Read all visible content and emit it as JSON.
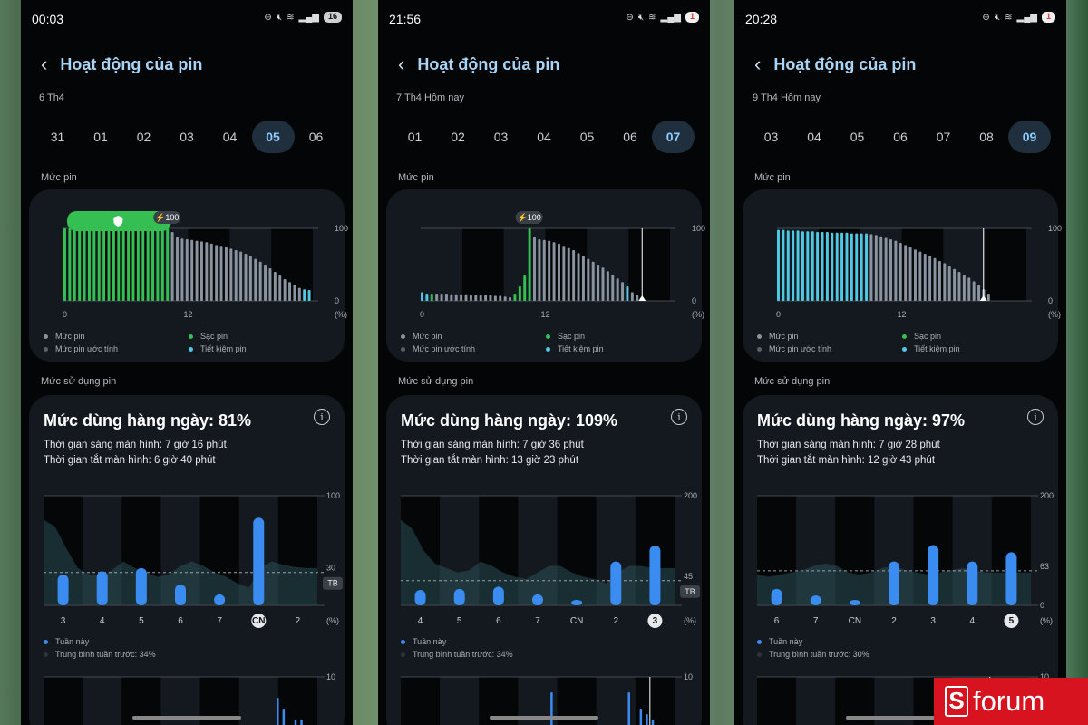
{
  "colors": {
    "battery_level": "#8a93a0",
    "charging": "#35bf52",
    "saving": "#4fc8e3",
    "usage_bar": "#3b8cf0",
    "screen_bg": "#040506",
    "card_bg": "#14191f",
    "title_accent": "#a9d4f5"
  },
  "icons": {
    "back": "chevron-left-icon",
    "info": "info-circle-icon",
    "charge": "lightning-bolt-icon",
    "shield": "shield-icon"
  },
  "phones": [
    {
      "status": {
        "time": "00:03",
        "battery": "16",
        "battery_low": false
      },
      "title": "Hoạt động của pin",
      "date_label": "6 Th4",
      "days": [
        "31",
        "01",
        "02",
        "03",
        "04",
        "05",
        "06"
      ],
      "selected_day": "05",
      "battery_section_label": "Mức pin",
      "battery_chart": {
        "y_max": "100",
        "y_min": "0",
        "unit": "(%)",
        "x_labels": [
          "0",
          "12"
        ],
        "charge_badge": "100",
        "has_shield_band": true,
        "cursor": null,
        "bars": [
          {
            "v": 100,
            "t": "c"
          },
          {
            "v": 100,
            "t": "c"
          },
          {
            "v": 100,
            "t": "c"
          },
          {
            "v": 100,
            "t": "c"
          },
          {
            "v": 100,
            "t": "c"
          },
          {
            "v": 100,
            "t": "c"
          },
          {
            "v": 100,
            "t": "c"
          },
          {
            "v": 100,
            "t": "c"
          },
          {
            "v": 100,
            "t": "c"
          },
          {
            "v": 100,
            "t": "c"
          },
          {
            "v": 100,
            "t": "c"
          },
          {
            "v": 100,
            "t": "c"
          },
          {
            "v": 100,
            "t": "c"
          },
          {
            "v": 100,
            "t": "c"
          },
          {
            "v": 100,
            "t": "c"
          },
          {
            "v": 100,
            "t": "c"
          },
          {
            "v": 100,
            "t": "c"
          },
          {
            "v": 100,
            "t": "c"
          },
          {
            "v": 100,
            "t": "c"
          },
          {
            "v": 100,
            "t": "c"
          },
          {
            "v": 100,
            "t": "c"
          },
          {
            "v": 100,
            "t": "c"
          },
          {
            "v": 95,
            "t": "n"
          },
          {
            "v": 88,
            "t": "n"
          },
          {
            "v": 86,
            "t": "n"
          },
          {
            "v": 85,
            "t": "n"
          },
          {
            "v": 84,
            "t": "n"
          },
          {
            "v": 83,
            "t": "n"
          },
          {
            "v": 82,
            "t": "n"
          },
          {
            "v": 81,
            "t": "n"
          },
          {
            "v": 79,
            "t": "n"
          },
          {
            "v": 77,
            "t": "n"
          },
          {
            "v": 76,
            "t": "n"
          },
          {
            "v": 74,
            "t": "n"
          },
          {
            "v": 72,
            "t": "n"
          },
          {
            "v": 70,
            "t": "n"
          },
          {
            "v": 68,
            "t": "n"
          },
          {
            "v": 65,
            "t": "n"
          },
          {
            "v": 62,
            "t": "n"
          },
          {
            "v": 58,
            "t": "n"
          },
          {
            "v": 54,
            "t": "n"
          },
          {
            "v": 50,
            "t": "n"
          },
          {
            "v": 45,
            "t": "n"
          },
          {
            "v": 40,
            "t": "n"
          },
          {
            "v": 35,
            "t": "n"
          },
          {
            "v": 30,
            "t": "n"
          },
          {
            "v": 26,
            "t": "n"
          },
          {
            "v": 22,
            "t": "n"
          },
          {
            "v": 18,
            "t": "n"
          },
          {
            "v": 16,
            "t": "s"
          },
          {
            "v": 15,
            "t": "s"
          }
        ]
      },
      "legend": {
        "level": "Mức pin",
        "estimated": "Mức pin ước tính",
        "charging": "Sạc pin",
        "saving": "Tiết kiệm pin"
      },
      "usage_section_label": "Mức sử dụng pin",
      "usage_title": "Mức dùng hàng ngày: 81%",
      "screen_on": "Thời gian sáng màn hình: 7 giờ 16 phút",
      "screen_off": "Thời gian tắt màn hình: 6 giờ 40 phút",
      "usage_chart": {
        "y_max": 100,
        "avg": 30,
        "y_max_label": "100",
        "avg_label": "30",
        "tb_label": "TB",
        "unit": "(%)",
        "y_min_label": "",
        "days": [
          "3",
          "4",
          "5",
          "6",
          "7",
          "CN",
          "2"
        ],
        "values": [
          28,
          31,
          34,
          19,
          10,
          80,
          null
        ],
        "highlight": "CN",
        "shade": [
          78,
          72,
          52,
          34,
          28,
          27,
          32,
          40,
          34,
          30,
          26,
          28,
          36,
          40,
          36,
          30,
          26,
          20,
          16,
          34,
          40,
          37,
          35,
          34,
          34
        ]
      },
      "this_week": "Tuần này",
      "last_week_avg": "Trung bình tuần trước: 34%",
      "bottom_chart_label": "10",
      "bottom_bars": [
        0,
        0,
        0,
        0,
        0,
        0,
        0,
        0,
        0,
        0,
        0,
        0,
        0,
        0,
        0,
        0,
        0,
        0,
        0,
        0,
        0,
        0,
        0,
        0,
        0,
        0,
        0,
        0,
        0,
        0,
        0,
        0,
        0,
        0,
        0,
        0,
        0,
        0,
        0,
        7,
        5,
        2,
        3,
        3,
        0,
        0
      ]
    },
    {
      "status": {
        "time": "21:56",
        "battery": "1",
        "battery_low": true
      },
      "title": "Hoạt động của pin",
      "date_label": "7 Th4 Hôm nay",
      "days": [
        "01",
        "02",
        "03",
        "04",
        "05",
        "06",
        "07"
      ],
      "selected_day": "07",
      "battery_section_label": "Mức pin",
      "battery_chart": {
        "y_max": "100",
        "y_min": "0",
        "unit": "(%)",
        "x_labels": [
          "0",
          "12"
        ],
        "charge_badge": "100",
        "has_shield_band": false,
        "cursor": 0.91,
        "bars": [
          {
            "v": 12,
            "t": "s"
          },
          {
            "v": 10,
            "t": "s"
          },
          {
            "v": 10,
            "t": "c"
          },
          {
            "v": 10,
            "t": "n"
          },
          {
            "v": 10,
            "t": "n"
          },
          {
            "v": 10,
            "t": "n"
          },
          {
            "v": 9,
            "t": "n"
          },
          {
            "v": 9,
            "t": "n"
          },
          {
            "v": 9,
            "t": "n"
          },
          {
            "v": 9,
            "t": "n"
          },
          {
            "v": 8,
            "t": "n"
          },
          {
            "v": 8,
            "t": "n"
          },
          {
            "v": 8,
            "t": "n"
          },
          {
            "v": 8,
            "t": "n"
          },
          {
            "v": 8,
            "t": "n"
          },
          {
            "v": 7,
            "t": "n"
          },
          {
            "v": 7,
            "t": "n"
          },
          {
            "v": 6,
            "t": "n"
          },
          {
            "v": 5,
            "t": "n"
          },
          {
            "v": 10,
            "t": "c"
          },
          {
            "v": 20,
            "t": "c"
          },
          {
            "v": 35,
            "t": "c"
          },
          {
            "v": 100,
            "t": "c"
          },
          {
            "v": 88,
            "t": "n"
          },
          {
            "v": 85,
            "t": "n"
          },
          {
            "v": 84,
            "t": "n"
          },
          {
            "v": 83,
            "t": "n"
          },
          {
            "v": 81,
            "t": "n"
          },
          {
            "v": 79,
            "t": "n"
          },
          {
            "v": 76,
            "t": "n"
          },
          {
            "v": 73,
            "t": "n"
          },
          {
            "v": 70,
            "t": "n"
          },
          {
            "v": 66,
            "t": "n"
          },
          {
            "v": 62,
            "t": "n"
          },
          {
            "v": 58,
            "t": "n"
          },
          {
            "v": 54,
            "t": "n"
          },
          {
            "v": 50,
            "t": "n"
          },
          {
            "v": 46,
            "t": "n"
          },
          {
            "v": 41,
            "t": "n"
          },
          {
            "v": 36,
            "t": "n"
          },
          {
            "v": 31,
            "t": "n"
          },
          {
            "v": 26,
            "t": "n"
          },
          {
            "v": 20,
            "t": "s"
          },
          {
            "v": 12,
            "t": "n"
          },
          {
            "v": 8,
            "t": "n"
          }
        ]
      },
      "legend": {
        "level": "Mức pin",
        "estimated": "Mức pin ước tính",
        "charging": "Sạc pin",
        "saving": "Tiết kiệm pin"
      },
      "usage_section_label": "Mức sử dụng pin",
      "usage_title": "Mức dùng hàng ngày: 109%",
      "screen_on": "Thời gian sáng màn hình: 7 giờ 36 phút",
      "screen_off": "Thời gian tắt màn hình: 13 giờ 23 phút",
      "usage_chart": {
        "y_max": 200,
        "avg": 45,
        "y_max_label": "200",
        "avg_label": "45",
        "tb_label": "TB",
        "unit": "(%)",
        "y_min_label": "",
        "days": [
          "4",
          "5",
          "6",
          "7",
          "CN",
          "2",
          "3"
        ],
        "values": [
          28,
          30,
          34,
          20,
          10,
          80,
          109
        ],
        "highlight": "3",
        "shade": [
          78,
          70,
          50,
          38,
          34,
          30,
          32,
          40,
          36,
          30,
          26,
          24,
          30,
          36,
          36,
          30,
          26,
          24,
          20,
          30,
          36,
          36,
          34,
          34,
          34
        ]
      },
      "this_week": "Tuần này",
      "last_week_avg": "Trung bình tuần trước: 34%",
      "bottom_chart_label": "10",
      "bottom_bars": [
        0,
        0,
        0,
        0,
        0,
        0,
        0,
        0,
        0,
        0,
        0,
        0,
        0,
        0,
        0,
        0,
        0,
        0,
        0,
        0,
        0,
        0,
        0,
        0,
        0,
        8,
        0,
        0,
        0,
        0,
        0,
        0,
        0,
        0,
        0,
        0,
        0,
        0,
        8,
        0,
        5,
        4,
        3,
        0,
        0,
        0
      ]
    },
    {
      "status": {
        "time": "20:28",
        "battery": "1",
        "battery_low": true
      },
      "title": "Hoạt động của pin",
      "date_label": "9 Th4 Hôm nay",
      "days": [
        "03",
        "04",
        "05",
        "06",
        "07",
        "08",
        "09"
      ],
      "selected_day": "09",
      "battery_section_label": "Mức pin",
      "battery_chart": {
        "y_max": "100",
        "y_min": "0",
        "unit": "(%)",
        "x_labels": [
          "0",
          "12"
        ],
        "charge_badge": "",
        "has_shield_band": false,
        "cursor": 0.85,
        "bars": [
          {
            "v": 98,
            "t": "s"
          },
          {
            "v": 98,
            "t": "s"
          },
          {
            "v": 97,
            "t": "s"
          },
          {
            "v": 97,
            "t": "s"
          },
          {
            "v": 97,
            "t": "s"
          },
          {
            "v": 96,
            "t": "s"
          },
          {
            "v": 96,
            "t": "s"
          },
          {
            "v": 96,
            "t": "s"
          },
          {
            "v": 95,
            "t": "s"
          },
          {
            "v": 95,
            "t": "s"
          },
          {
            "v": 95,
            "t": "s"
          },
          {
            "v": 94,
            "t": "s"
          },
          {
            "v": 94,
            "t": "s"
          },
          {
            "v": 94,
            "t": "s"
          },
          {
            "v": 94,
            "t": "s"
          },
          {
            "v": 93,
            "t": "s"
          },
          {
            "v": 93,
            "t": "s"
          },
          {
            "v": 93,
            "t": "s"
          },
          {
            "v": 93,
            "t": "s"
          },
          {
            "v": 92,
            "t": "n"
          },
          {
            "v": 91,
            "t": "n"
          },
          {
            "v": 89,
            "t": "n"
          },
          {
            "v": 87,
            "t": "n"
          },
          {
            "v": 85,
            "t": "n"
          },
          {
            "v": 83,
            "t": "n"
          },
          {
            "v": 80,
            "t": "n"
          },
          {
            "v": 77,
            "t": "n"
          },
          {
            "v": 74,
            "t": "n"
          },
          {
            "v": 71,
            "t": "n"
          },
          {
            "v": 68,
            "t": "n"
          },
          {
            "v": 65,
            "t": "n"
          },
          {
            "v": 62,
            "t": "n"
          },
          {
            "v": 59,
            "t": "n"
          },
          {
            "v": 55,
            "t": "n"
          },
          {
            "v": 52,
            "t": "n"
          },
          {
            "v": 48,
            "t": "n"
          },
          {
            "v": 44,
            "t": "n"
          },
          {
            "v": 40,
            "t": "n"
          },
          {
            "v": 36,
            "t": "n"
          },
          {
            "v": 32,
            "t": "n"
          },
          {
            "v": 27,
            "t": "n"
          },
          {
            "v": 22,
            "t": "n"
          },
          {
            "v": 16,
            "t": "n"
          },
          {
            "v": 10,
            "t": "n"
          }
        ]
      },
      "legend": {
        "level": "Mức pin",
        "estimated": "Mức pin ước tính",
        "charging": "Sạc pin",
        "saving": "Tiết kiệm pin"
      },
      "usage_section_label": "Mức sử dụng pin",
      "usage_title": "Mức dùng hàng ngày: 97%",
      "screen_on": "Thời gian sáng màn hình: 7 giờ 28 phút",
      "screen_off": "Thời gian tắt màn hình: 12 giờ 43 phút",
      "usage_chart": {
        "y_max": 200,
        "avg": 63,
        "y_max_label": "200",
        "avg_label": "63",
        "tb_label": "",
        "unit": "(%)",
        "y_min_label": "0",
        "days": [
          "6",
          "7",
          "CN",
          "2",
          "3",
          "4",
          "5"
        ],
        "values": [
          30,
          18,
          10,
          80,
          110,
          80,
          97
        ],
        "highlight": "5",
        "shade": [
          28,
          26,
          28,
          30,
          32,
          36,
          38,
          36,
          30,
          28,
          30,
          34,
          36,
          32,
          30,
          28,
          30,
          32,
          34,
          32,
          30,
          30,
          30,
          30,
          30
        ]
      },
      "this_week": "Tuần này",
      "last_week_avg": "Trung bình tuần trước: 30%",
      "bottom_chart_label": "10",
      "bottom_bars": [
        0,
        0,
        0,
        0,
        0,
        0,
        0,
        0,
        0,
        0,
        0,
        0,
        0,
        0,
        0,
        0,
        0,
        0,
        0,
        0,
        0,
        0,
        0,
        0,
        0,
        0,
        0,
        0,
        0,
        0,
        0,
        0,
        0,
        0,
        0,
        0,
        0,
        0,
        0,
        0,
        8,
        0,
        5,
        3,
        0,
        0
      ]
    }
  ],
  "watermark": {
    "letter": "S",
    "word": "forum"
  }
}
